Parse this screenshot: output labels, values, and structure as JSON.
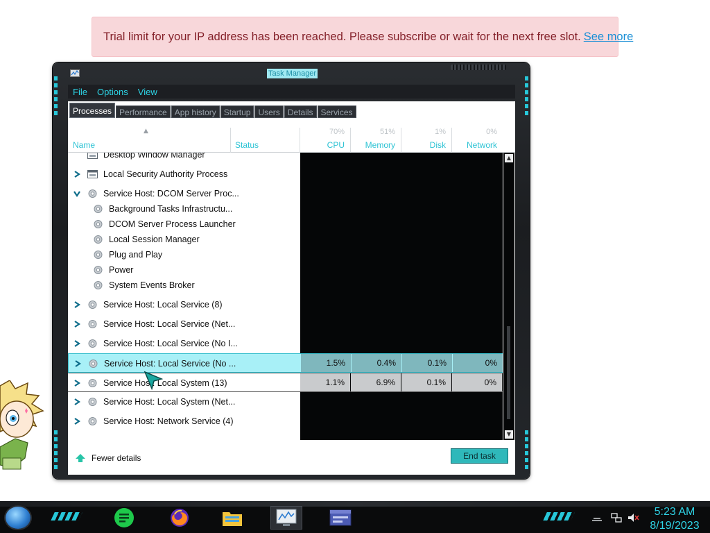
{
  "banner": {
    "message": "Trial limit for your IP address has been reached. Please subscribe or wait for the next free slot.",
    "link": "See more"
  },
  "window": {
    "title": "Task Manager",
    "menu": [
      "File",
      "Options",
      "View"
    ],
    "tabs": [
      "Processes",
      "Performance",
      "App history",
      "Startup",
      "Users",
      "Details",
      "Services"
    ],
    "active_tab": "Processes"
  },
  "columns": {
    "name": "Name",
    "status": "Status",
    "cpu": {
      "label": "CPU",
      "total": "70%"
    },
    "memory": {
      "label": "Memory",
      "total": "51%"
    },
    "disk": {
      "label": "Disk",
      "total": "1%"
    },
    "network": {
      "label": "Network",
      "total": "0%"
    }
  },
  "processes": [
    {
      "name": "Desktop Window Manager",
      "type": "app",
      "partial": true
    },
    {
      "name": "Local Security Authority Process",
      "type": "app",
      "expander": "collapsed"
    },
    {
      "name": "Service Host: DCOM Server Proc...",
      "type": "service",
      "expander": "expanded"
    },
    {
      "name": "Background Tasks Infrastructu...",
      "type": "child"
    },
    {
      "name": "DCOM Server Process Launcher",
      "type": "child"
    },
    {
      "name": "Local Session Manager",
      "type": "child"
    },
    {
      "name": "Plug and Play",
      "type": "child"
    },
    {
      "name": "Power",
      "type": "child"
    },
    {
      "name": "System Events Broker",
      "type": "child"
    },
    {
      "name": "Service Host: Local Service (8)",
      "type": "service",
      "expander": "collapsed"
    },
    {
      "name": "Service Host: Local Service (Net...",
      "type": "service",
      "expander": "collapsed"
    },
    {
      "name": "Service Host: Local Service (No I...",
      "type": "service",
      "expander": "collapsed"
    },
    {
      "name": "Service Host: Local Service (No ...",
      "type": "service",
      "expander": "collapsed",
      "state": "hover",
      "cpu": "1.5%",
      "memory": "0.4%",
      "disk": "0.1%",
      "network": "0%"
    },
    {
      "name": "Service Host: Local System (13)",
      "type": "service",
      "expander": "collapsed",
      "state": "selected",
      "cpu": "1.1%",
      "memory": "6.9%",
      "disk": "0.1%",
      "network": "0%"
    },
    {
      "name": "Service Host: Local System (Net...",
      "type": "service",
      "expander": "collapsed"
    },
    {
      "name": "Service Host: Network Service (4)",
      "type": "service",
      "expander": "collapsed"
    }
  ],
  "footer": {
    "fewer_details": "Fewer details",
    "end_task": "End task"
  },
  "taskbar": {
    "apps": [
      "notes-app-icon",
      "firefox-icon",
      "file-explorer-icon",
      "task-manager-icon",
      "app-window-icon"
    ],
    "active_app": "task-manager-icon",
    "time": "5:23 AM",
    "date": "8/19/2023"
  },
  "colors": {
    "accent": "#2dd4e6",
    "banner_bg": "#f8d7da",
    "banner_text": "#842029",
    "link": "#1a8fd6",
    "highlight_row": "#a8f0f7"
  }
}
